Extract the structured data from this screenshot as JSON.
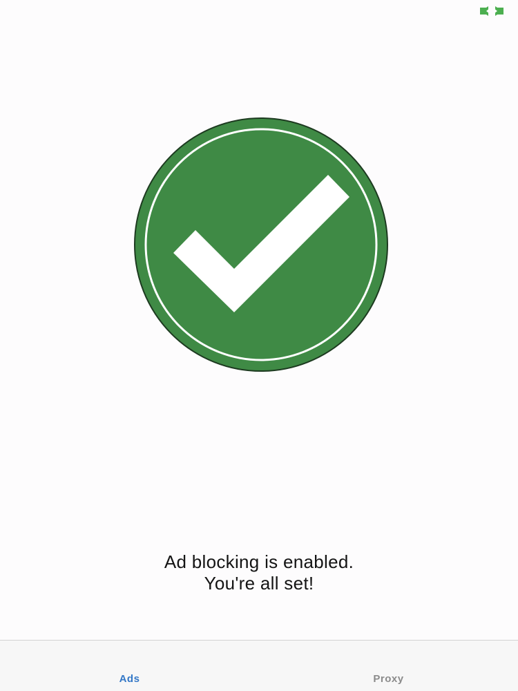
{
  "status_bar": {
    "indicator_icon": "green-connection-icon",
    "indicator_color": "#4caf50"
  },
  "hero": {
    "icon": "checkmark-circle-icon",
    "fill_color": "#3f8a45",
    "ring_color": "#ffffff",
    "check_color": "#ffffff",
    "outline_color": "#1d3a20"
  },
  "message": {
    "line1": "Ad blocking is enabled.",
    "line2": "You're all set!"
  },
  "tab_bar": {
    "tabs": [
      {
        "label": "Ads",
        "active": true,
        "color": "#3478c7"
      },
      {
        "label": "Proxy",
        "active": false,
        "color": "#8b8b8b"
      }
    ]
  }
}
